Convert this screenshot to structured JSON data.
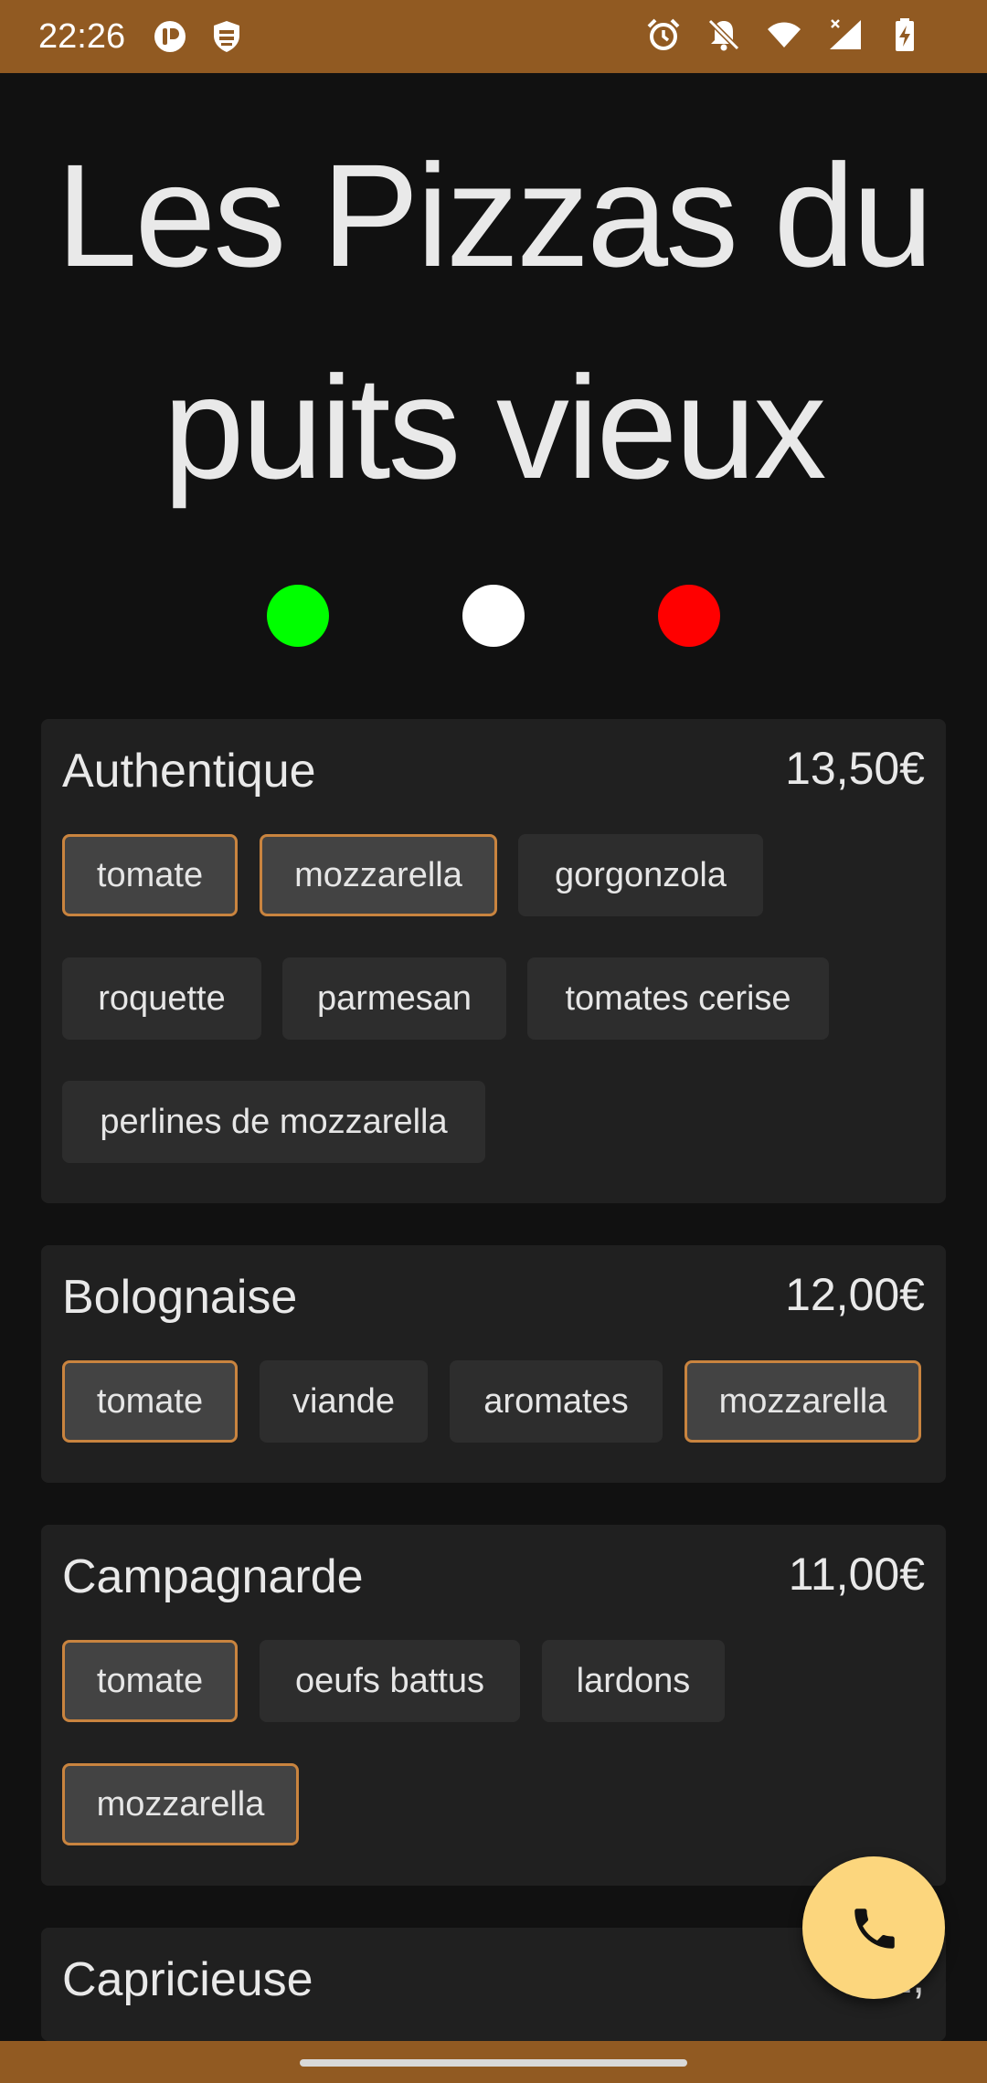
{
  "status_bar": {
    "time": "22:26",
    "left_icons": [
      "app-notification-icon",
      "vpn-shield-icon"
    ],
    "right_icons": [
      "alarm-icon",
      "do-not-disturb-icon",
      "wifi-icon",
      "signal-icon",
      "battery-charging-icon"
    ],
    "background": "#915a22"
  },
  "header": {
    "title": "Les Pizzas du puits vieux"
  },
  "flag_dots": [
    "#00ff00",
    "#ffffff",
    "#ff0000"
  ],
  "highlight_color": "#c9843f",
  "pizzas": [
    {
      "name": "Authentique",
      "price": "13,50€",
      "ingredients": [
        {
          "label": "tomate",
          "highlighted": true
        },
        {
          "label": "mozzarella",
          "highlighted": true
        },
        {
          "label": "gorgonzola",
          "highlighted": false
        },
        {
          "label": "roquette",
          "highlighted": false
        },
        {
          "label": "parmesan",
          "highlighted": false
        },
        {
          "label": "tomates cerise",
          "highlighted": false
        },
        {
          "label": "perlines de mozzarella",
          "highlighted": false
        }
      ]
    },
    {
      "name": "Bolognaise",
      "price": "12,00€",
      "ingredients": [
        {
          "label": "tomate",
          "highlighted": true
        },
        {
          "label": "viande",
          "highlighted": false
        },
        {
          "label": "aromates",
          "highlighted": false
        },
        {
          "label": "mozzarella",
          "highlighted": true
        }
      ]
    },
    {
      "name": "Campagnarde",
      "price": "11,00€",
      "ingredients": [
        {
          "label": "tomate",
          "highlighted": true
        },
        {
          "label": "oeufs battus",
          "highlighted": false
        },
        {
          "label": "lardons",
          "highlighted": false
        },
        {
          "label": "mozzarella",
          "highlighted": true
        }
      ]
    },
    {
      "name": "Capricieuse",
      "price": "11,",
      "ingredients": []
    }
  ],
  "fab": {
    "icon": "phone-icon",
    "color": "#fcd67d"
  }
}
